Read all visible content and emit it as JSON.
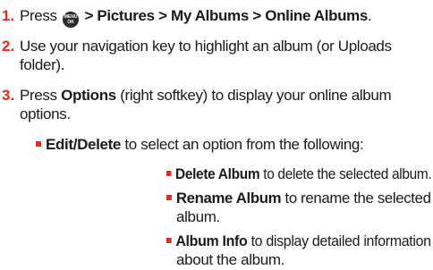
{
  "steps": [
    {
      "number": "1.",
      "press": "Press",
      "menu_icon_top": "MENU",
      "menu_icon_bottom": "OK",
      "path": "> Pictures > My Albums > Online Albums",
      "period": "."
    },
    {
      "number": "2.",
      "line1": "Use your navigation key to highlight an album (or Uploads",
      "line2": "folder)."
    },
    {
      "number": "3.",
      "press": "Press",
      "options": "Options",
      "line1_rest": "(right softkey) to display your online album",
      "line2": "options."
    }
  ],
  "sub_item": {
    "label": "Edit/Delete",
    "text": "to select an option from the following:"
  },
  "options": [
    {
      "label": "Delete Album",
      "line1": "to delete the selected album."
    },
    {
      "label": "Rename Album",
      "line1": "to rename the selected",
      "line2": "album."
    },
    {
      "label": "Album Info",
      "line1": "to display detailed information",
      "line2": "about the album."
    }
  ],
  "colors": {
    "accent": "#e8291c",
    "text": "#1a1a1a",
    "icon": "#2b2b2b"
  },
  "icons": {
    "menu": "menu-ok-key-icon",
    "bullet": "red-square-bullet"
  }
}
